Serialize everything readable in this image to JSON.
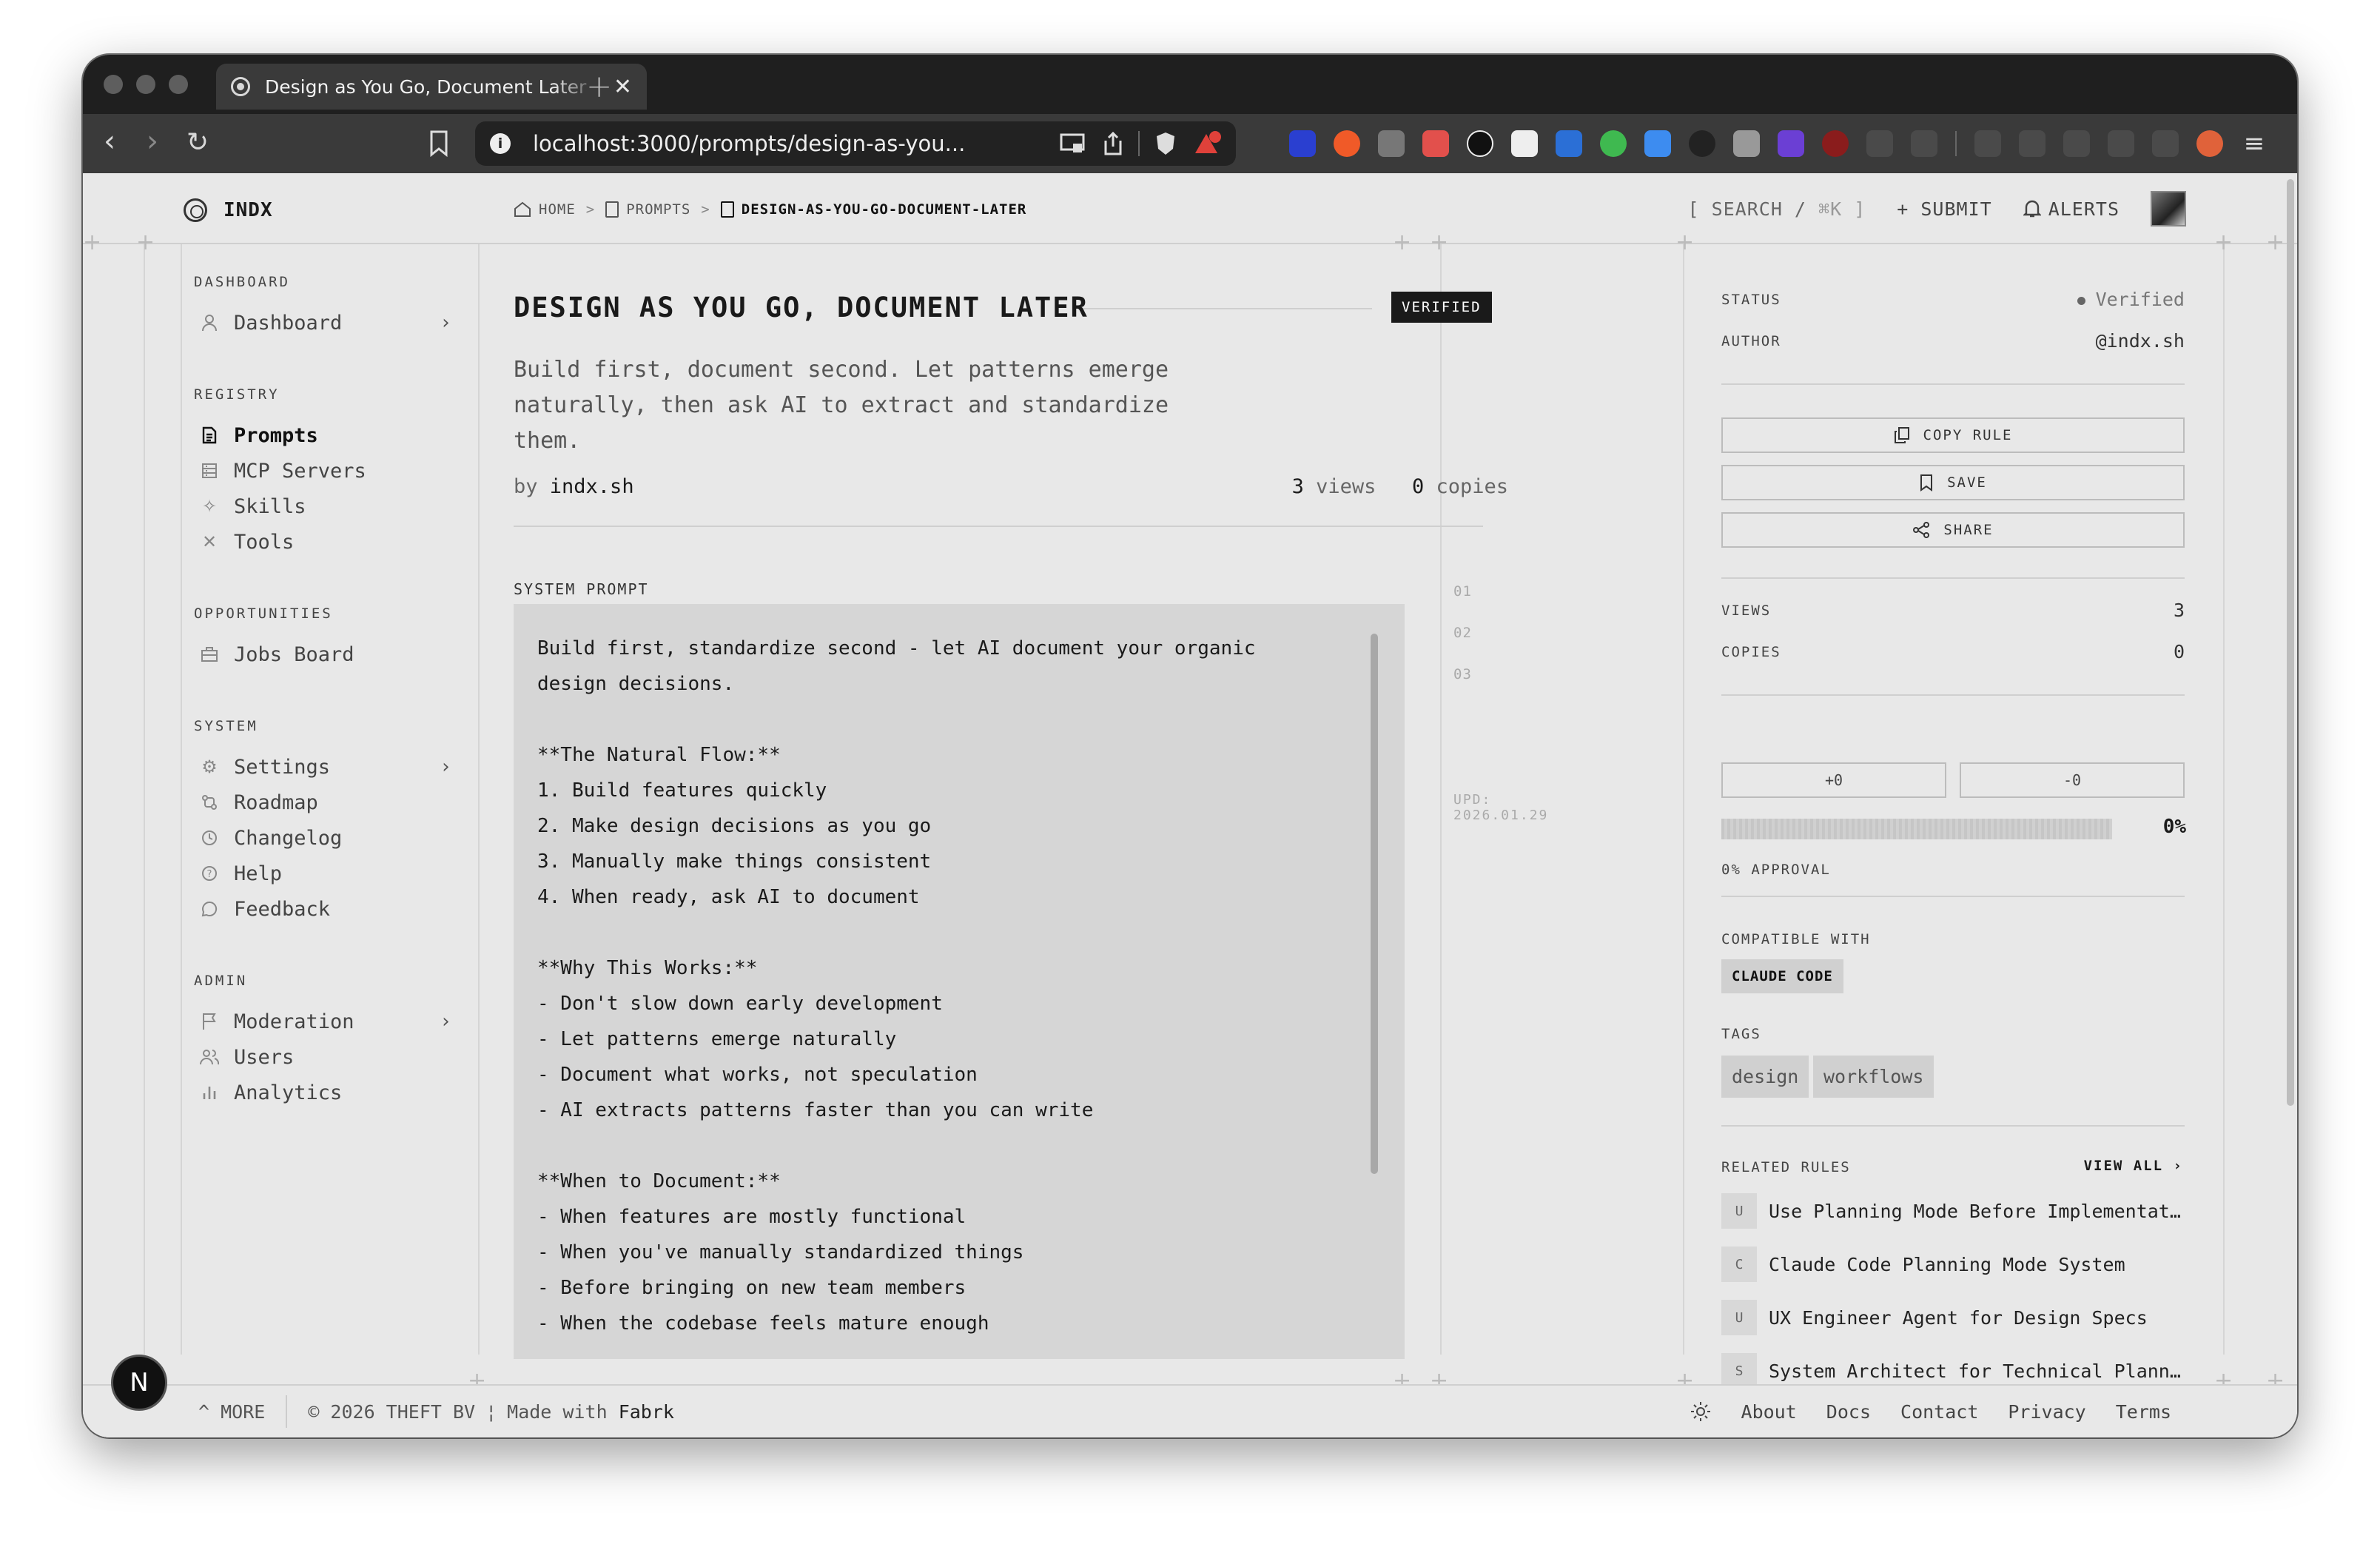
{
  "browser": {
    "tab_title": "Design as You Go, Document Later",
    "tab_close": "✕",
    "new_tab": "+",
    "url": "localhost:3000/prompts/design-as-you..."
  },
  "header": {
    "brand": "INDX",
    "breadcrumb": [
      "HOME",
      "PROMPTS",
      "DESIGN-AS-YOU-GO-DOCUMENT-LATER"
    ],
    "search_label": "[ SEARCH / ",
    "search_key": "⌘K ]",
    "submit": "SUBMIT",
    "alerts": "ALERTS"
  },
  "sidebar": {
    "sections": [
      {
        "label": "DASHBOARD",
        "items": [
          {
            "label": "Dashboard",
            "icon": "user-icon",
            "chevron": true
          }
        ]
      },
      {
        "label": "REGISTRY",
        "items": [
          {
            "label": "Prompts",
            "icon": "document-icon",
            "active": true
          },
          {
            "label": "MCP Servers",
            "icon": "server-icon"
          },
          {
            "label": "Skills",
            "icon": "sparkle-icon"
          },
          {
            "label": "Tools",
            "icon": "tools-icon"
          }
        ]
      },
      {
        "label": "OPPORTUNITIES",
        "items": [
          {
            "label": "Jobs Board",
            "icon": "briefcase-icon"
          }
        ]
      },
      {
        "label": "SYSTEM",
        "items": [
          {
            "label": "Settings",
            "icon": "gear-icon",
            "chevron": true
          },
          {
            "label": "Roadmap",
            "icon": "route-icon"
          },
          {
            "label": "Changelog",
            "icon": "history-icon"
          },
          {
            "label": "Help",
            "icon": "help-icon"
          },
          {
            "label": "Feedback",
            "icon": "chat-icon"
          }
        ]
      },
      {
        "label": "ADMIN",
        "items": [
          {
            "label": "Moderation",
            "icon": "flag-icon",
            "chevron": true
          },
          {
            "label": "Users",
            "icon": "users-icon"
          },
          {
            "label": "Analytics",
            "icon": "chart-icon"
          }
        ]
      }
    ]
  },
  "main": {
    "title": "DESIGN AS YOU GO, DOCUMENT LATER",
    "badge": "VERIFIED",
    "description": "Build first, document second. Let patterns emerge naturally, then ask AI to extract and standardize them.",
    "by_prefix": "by ",
    "author": "indx.sh",
    "views_count": "3",
    "views_label": " views",
    "copies_count": "0",
    "copies_label": " copies",
    "system_prompt_label": "SYSTEM PROMPT",
    "system_prompt": "Build first, standardize second - let AI document your organic design decisions.\n\n**The Natural Flow:**\n1. Build features quickly\n2. Make design decisions as you go\n3. Manually make things consistent\n4. When ready, ask AI to document\n\n**Why This Works:**\n- Don't slow down early development\n- Let patterns emerge naturally\n- Document what works, not speculation\n- AI extracts patterns faster than you can write\n\n**When to Document:**\n- When features are mostly functional\n- When you've manually standardized things\n- Before bringing on new team members\n- When the codebase feels mature enough",
    "line_numbers": [
      "01",
      "02",
      "03"
    ],
    "updated": "UPD: 2026.01.29"
  },
  "panel": {
    "status_label": "STATUS",
    "status_value": "Verified",
    "author_label": "AUTHOR",
    "author_value": "@indx.sh",
    "copy_rule": "COPY RULE",
    "save": "SAVE",
    "share": "SHARE",
    "views_label": "VIEWS",
    "views_value": "3",
    "copies_label": "COPIES",
    "copies_value": "0",
    "upvote": "+0",
    "downvote": "-0",
    "approval_percent": 0,
    "approval_pct_text": "0%",
    "approval_label": "0% APPROVAL",
    "compatible_label": "COMPATIBLE WITH",
    "compatible": [
      "CLAUDE CODE"
    ],
    "tags_label": "TAGS",
    "tags": [
      "design",
      "workflows"
    ],
    "related_label": "RELATED RULES",
    "view_all": "VIEW ALL ›",
    "related": [
      {
        "abbr": "U",
        "title": "Use Planning Mode Before Implementat…"
      },
      {
        "abbr": "C",
        "title": "Claude Code Planning Mode System"
      },
      {
        "abbr": "U",
        "title": "UX Engineer Agent for Design Specs"
      },
      {
        "abbr": "S",
        "title": "System Architect for Technical Plann…"
      }
    ]
  },
  "footer": {
    "more": "^ MORE",
    "copyright": "© 2026 THEFT BV",
    "made_with": "Made with",
    "made_with_brand": "Fabrk",
    "links": [
      "About",
      "Docs",
      "Contact",
      "Privacy",
      "Terms"
    ]
  },
  "overlay": {
    "bubble": "N"
  },
  "colors": {
    "accent": "#1a1a1a",
    "page_bg": "#e8e8e8",
    "code_bg": "#d6d6d6"
  }
}
